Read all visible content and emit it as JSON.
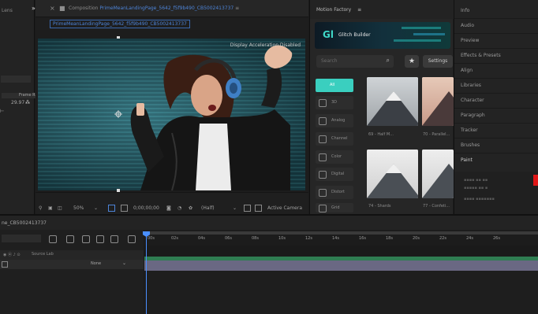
{
  "left_panel": {
    "title": "Lens",
    "field_a": "",
    "field_b": "29.97",
    "field_c": "Frame R."
  },
  "composition": {
    "header_text": "Composition",
    "comp_name": "PrimeMeanLandingPage_5642_f5f9b490_CB5002413737",
    "tab_label": "PrimeMeanLandingPage_5642_f5f9b490_CB5002413737",
    "overlay_text": "Display Acceleration Disabled",
    "zoom": "50%",
    "timecode": "0;00;00;00",
    "resolution": "(Half)",
    "camera": "Active Camera"
  },
  "motion_factory": {
    "title": "Motion Factory",
    "banner_logo": "Gl",
    "banner_name": "Glitch Builder",
    "search_placeholder": "Search",
    "settings_label": "Settings",
    "categories": [
      {
        "label": "All",
        "active": true
      },
      {
        "label": "3D"
      },
      {
        "label": "Analog"
      },
      {
        "label": "Channel"
      },
      {
        "label": "Color"
      },
      {
        "label": "Digital"
      },
      {
        "label": "Distort"
      },
      {
        "label": "Grid"
      }
    ],
    "thumbs": [
      {
        "label": "69 - Half M..."
      },
      {
        "label": "70 - Parallel..."
      },
      {
        "label": "74 - Shards"
      },
      {
        "label": "77 - Confeti..."
      }
    ]
  },
  "right_panel": {
    "items": [
      "Info",
      "Audio",
      "Preview",
      "Effects & Presets",
      "Align",
      "Libraries",
      "Character",
      "Paragraph",
      "Tracker",
      "Brushes",
      "Paint"
    ]
  },
  "timeline": {
    "comp_name": "ne_CB5002413737",
    "col_label": "Source Lab",
    "layer_mode": "None",
    "ticks": [
      "00s",
      "02s",
      "04s",
      "06s",
      "08s",
      "10s",
      "12s",
      "14s",
      "16s",
      "18s",
      "20s",
      "22s",
      "24s",
      "26s"
    ]
  },
  "colors": {
    "accent_blue": "#4d84d8",
    "teal": "#3acfbf",
    "track_green": "#2f7d52",
    "track_purple": "#6a6883",
    "paint_swatch": "#e01818"
  }
}
